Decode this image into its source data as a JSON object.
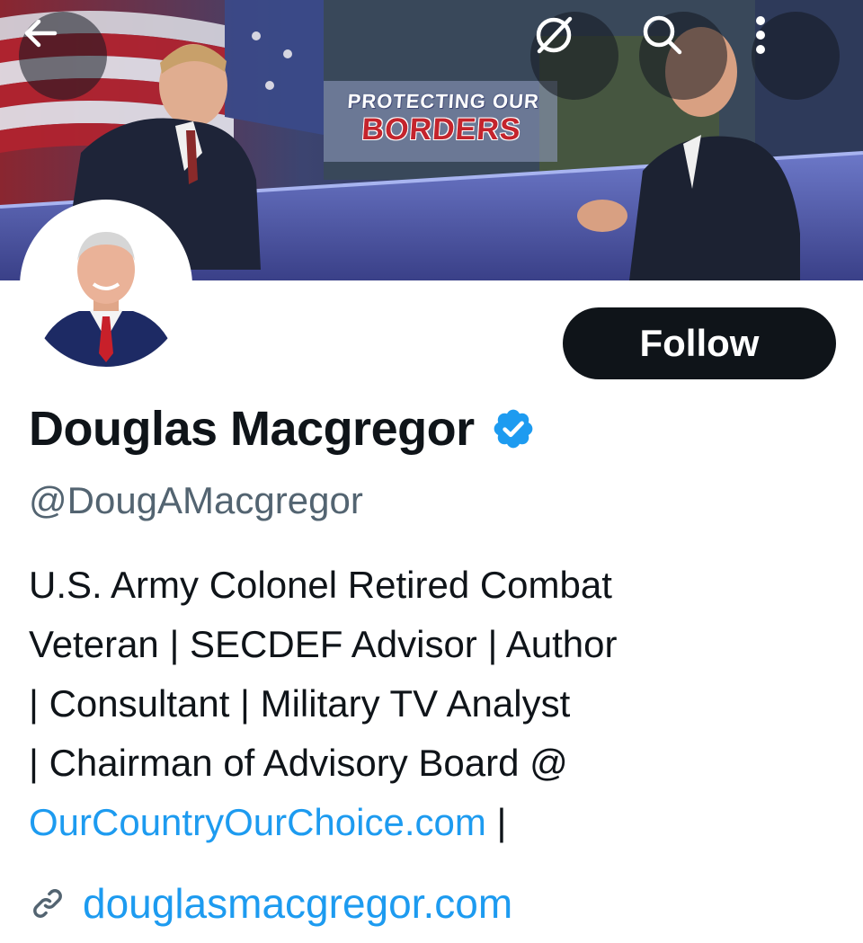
{
  "banner": {
    "caption_line1": "PROTECTING OUR",
    "caption_line2": "BORDERS"
  },
  "topbar": {
    "back_icon": "arrow-left-icon",
    "grok_icon": "slashed-circle-icon",
    "search_icon": "search-icon",
    "more_icon": "vertical-ellipsis-icon"
  },
  "profile": {
    "name": "Douglas Macgregor",
    "verified_icon": "verified-badge-icon",
    "handle": "@DougAMacgregor",
    "follow_label": "Follow",
    "bio": {
      "line1": "U.S. Army Colonel Retired Combat",
      "line2": "Veteran | SECDEF Advisor | Author",
      "line3": "| Consultant | Military TV Analyst",
      "line4": "| Chairman of Advisory Board @",
      "link": "OurCountryOurChoice.com",
      "after_link": " |"
    },
    "website_icon": "link-icon",
    "website": "douglasmacgregor.com"
  },
  "colors": {
    "accent": "#1d9bf0",
    "text": "#0f1419",
    "secondary_text": "#536471",
    "button_bg": "#0f1419"
  }
}
